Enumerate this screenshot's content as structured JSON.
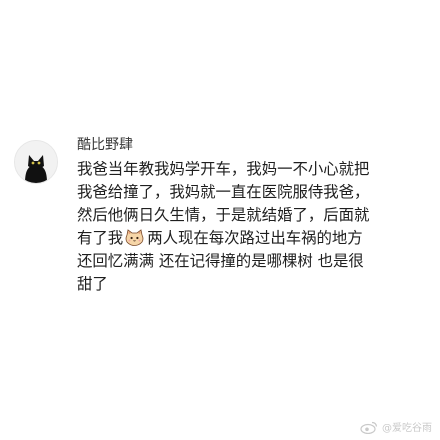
{
  "comment": {
    "username": "酷比野肆",
    "lines": [
      "我爸当年教我妈学开车，我妈一不小心就把",
      "我爸给撞了，我妈就一直在医院服侍我爸，",
      "然后他俩日久生情，于是就结婚了，后面就",
      "有了我",
      "两人现在每次路过出车祸的地方",
      "还回忆满满 还在记得撞的是哪棵树 也是很",
      "甜了"
    ],
    "inline_emoji": "cat-face-emoji"
  },
  "watermark": {
    "logo": "weibo-logo-icon",
    "text": "@爱吃谷雨"
  },
  "colors": {
    "background": "#ffffff",
    "text": "#1f1f1f",
    "username": "#3a3a3a",
    "watermark": "#c9c9c9"
  }
}
